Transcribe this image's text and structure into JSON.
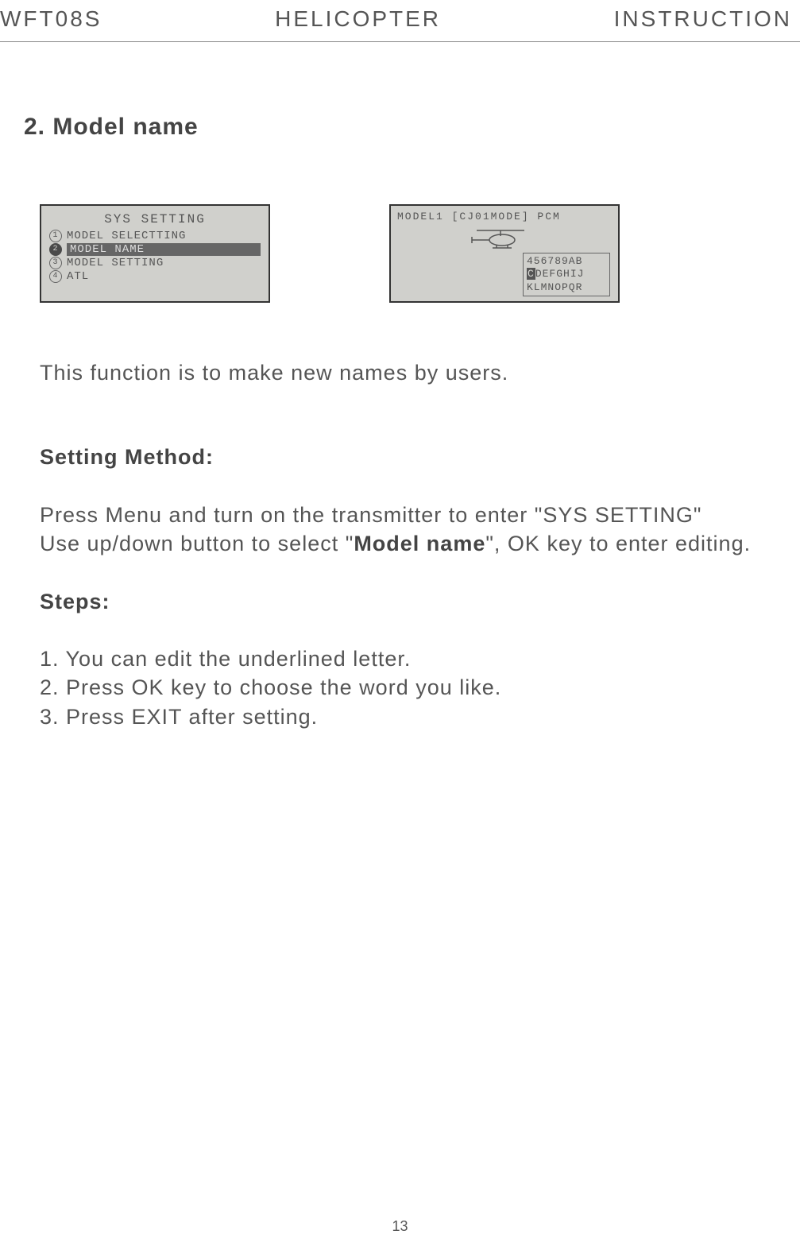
{
  "header": {
    "left": "WFT08S",
    "center": "HELICOPTER",
    "right": "INSTRUCTION"
  },
  "section_title": "2. Model name",
  "lcd_left": {
    "title": "SYS SETTING",
    "items": [
      {
        "num": "1",
        "label": "MODEL SELECTTING",
        "selected": false
      },
      {
        "num": "2",
        "label": "MODEL NAME",
        "selected": true
      },
      {
        "num": "3",
        "label": "MODEL SETTING",
        "selected": false
      },
      {
        "num": "4",
        "label": "ATL",
        "selected": false
      }
    ]
  },
  "lcd_right": {
    "top": "MODEL1 [CJ01MODE] PCM",
    "charbox": {
      "line1": "456789AB",
      "cursor": "C",
      "line2_rest": "DEFGHIJ",
      "line3": "KLMNOPQR"
    }
  },
  "intro": "This function is to make new names by users.",
  "setting_method_label": "Setting Method:",
  "setting_method_p1a": "Press Menu and turn on the transmitter to enter \"SYS SETTING\"",
  "setting_method_p2a": "Use up/down button to select \"",
  "setting_method_p2_bold": "Model name",
  "setting_method_p2b": "\", OK key to enter editing.",
  "steps_label": "Steps:",
  "steps": [
    "1. You can edit the underlined letter.",
    "2. Press OK key to choose the word you like.",
    "3. Press EXIT after setting."
  ],
  "page_number": "13"
}
